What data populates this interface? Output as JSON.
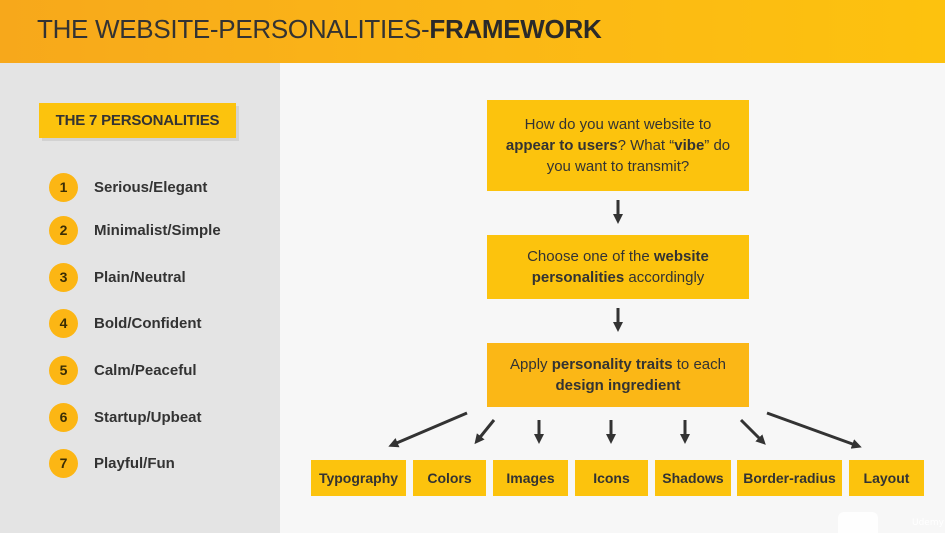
{
  "header": {
    "title_part1": "THE WEBSITE-PERSONALITIES-",
    "title_part2": "FRAMEWORK"
  },
  "sidebar": {
    "heading": "THE 7 PERSONALITIES",
    "items": [
      {
        "num": "1",
        "label": "Serious/Elegant"
      },
      {
        "num": "2",
        "label": "Minimalist/Simple"
      },
      {
        "num": "3",
        "label": "Plain/Neutral"
      },
      {
        "num": "4",
        "label": "Bold/Confident"
      },
      {
        "num": "5",
        "label": "Calm/Peaceful"
      },
      {
        "num": "6",
        "label": "Startup/Upbeat"
      },
      {
        "num": "7",
        "label": "Playful/Fun"
      }
    ]
  },
  "flow": {
    "box1": {
      "t1": "How do you want website to",
      "t2": "appear to users",
      "t3": "? What “",
      "t4": "vibe",
      "t5": "” do",
      "t6": "you want to transmit?"
    },
    "box2": {
      "t1": "Choose one of the ",
      "t2": "website",
      "t3": "personalities",
      "t4": " accordingly"
    },
    "box3": {
      "t1": "Apply ",
      "t2": "personality traits",
      "t3": " to each",
      "t4": "design ingredient"
    }
  },
  "ingredients": [
    "Typography",
    "Colors",
    "Images",
    "Icons",
    "Shadows",
    "Border-radius",
    "Layout"
  ],
  "watermark": "Udemy",
  "colors": {
    "accent": "#fcc30d",
    "accent_dark": "#fbb716",
    "sidebar_bg": "#e4e4e4",
    "text": "#333333",
    "arrow": "#333333"
  }
}
